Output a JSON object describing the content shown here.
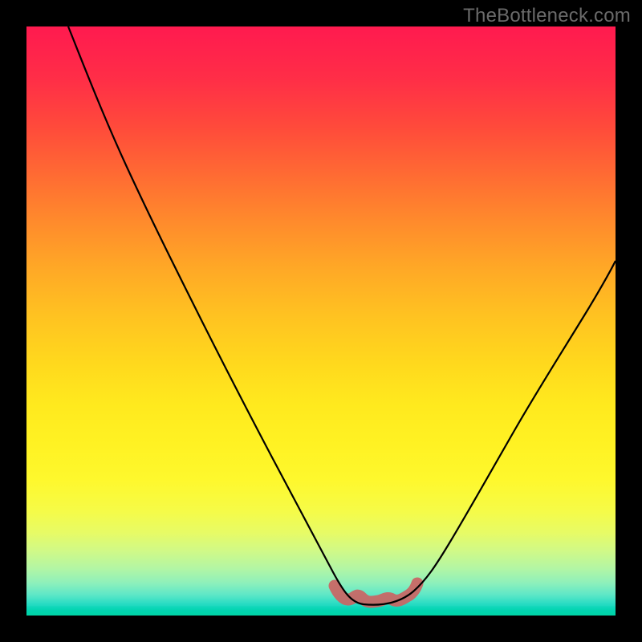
{
  "watermark": "TheBottleneck.com",
  "colors": {
    "frame": "#000000",
    "grad_top": "#ff1a4f",
    "grad_bottom": "#00d0ae",
    "marker": "#cb6463",
    "curve": "#000000"
  },
  "chart_data": {
    "type": "line",
    "title": "",
    "xlabel": "",
    "ylabel": "",
    "xlim": [
      0,
      100
    ],
    "ylim": [
      0,
      100
    ],
    "series": [
      {
        "name": "bottleneck-curve",
        "x": [
          7,
          10,
          15,
          20,
          25,
          30,
          35,
          40,
          45,
          50,
          53,
          56,
          58,
          61,
          64,
          66,
          70,
          75,
          80,
          85,
          90,
          95,
          100
        ],
        "y": [
          100,
          92,
          80,
          68,
          57,
          46,
          36,
          26,
          17,
          9,
          5,
          2.5,
          1.8,
          1.7,
          2.0,
          4,
          10,
          19,
          29,
          38,
          47,
          55,
          62
        ]
      }
    ],
    "highlight": {
      "name": "optimal-zone",
      "x_range": [
        53,
        66
      ],
      "y_approx": 2,
      "color": "#cb6463"
    }
  }
}
